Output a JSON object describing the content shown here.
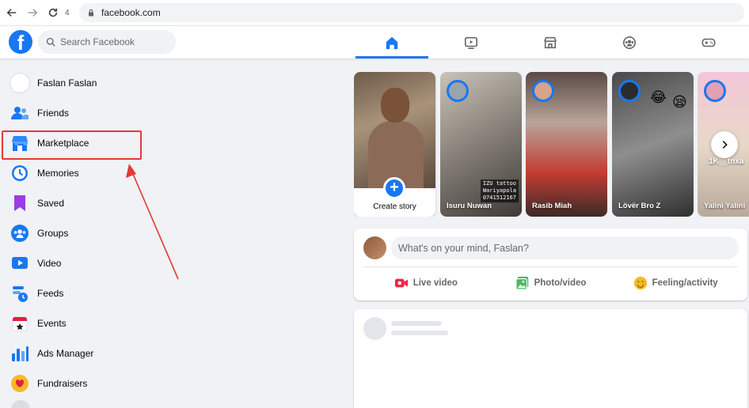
{
  "browser": {
    "tab_count": "4",
    "url": "facebook.com"
  },
  "header": {
    "logo_letter": "f",
    "search_placeholder": "Search Facebook",
    "nav": [
      "home-icon",
      "video-icon",
      "marketplace-icon",
      "groups-icon",
      "gaming-icon"
    ],
    "active_nav": "home-icon"
  },
  "sidebar": {
    "items": [
      {
        "label": "Faslan Faslan",
        "icon": "avatar"
      },
      {
        "label": "Friends",
        "icon": "friends-icon"
      },
      {
        "label": "Marketplace",
        "icon": "marketplace-icon"
      },
      {
        "label": "Memories",
        "icon": "memories-icon"
      },
      {
        "label": "Saved",
        "icon": "saved-icon"
      },
      {
        "label": "Groups",
        "icon": "groups-icon"
      },
      {
        "label": "Video",
        "icon": "video-icon"
      },
      {
        "label": "Feeds",
        "icon": "feeds-icon"
      },
      {
        "label": "Events",
        "icon": "events-icon"
      },
      {
        "label": "Ads Manager",
        "icon": "ads-manager-icon"
      },
      {
        "label": "Fundraisers",
        "icon": "fundraisers-icon"
      }
    ]
  },
  "stories": {
    "create_label": "Create story",
    "items": [
      {
        "name": "Isuru Nuwan",
        "caption_lines": [
          "IZU tattoo",
          "Wariyapola",
          "0741512167"
        ]
      },
      {
        "name": "Rasib Miah"
      },
      {
        "name": "Lövër Bro Z"
      },
      {
        "name": "Yalini Yalini",
        "overlay_text": "1K__tnxa"
      }
    ]
  },
  "composer": {
    "placeholder": "What's on your mind, Faslan?",
    "actions": [
      {
        "label": "Live video",
        "icon": "live-video-icon"
      },
      {
        "label": "Photo/video",
        "icon": "photo-video-icon"
      },
      {
        "label": "Feeling/activity",
        "icon": "feeling-activity-icon"
      }
    ]
  },
  "colors": {
    "brand": "#1877f2",
    "highlight": "#e53935",
    "background": "#f0f2f5"
  }
}
